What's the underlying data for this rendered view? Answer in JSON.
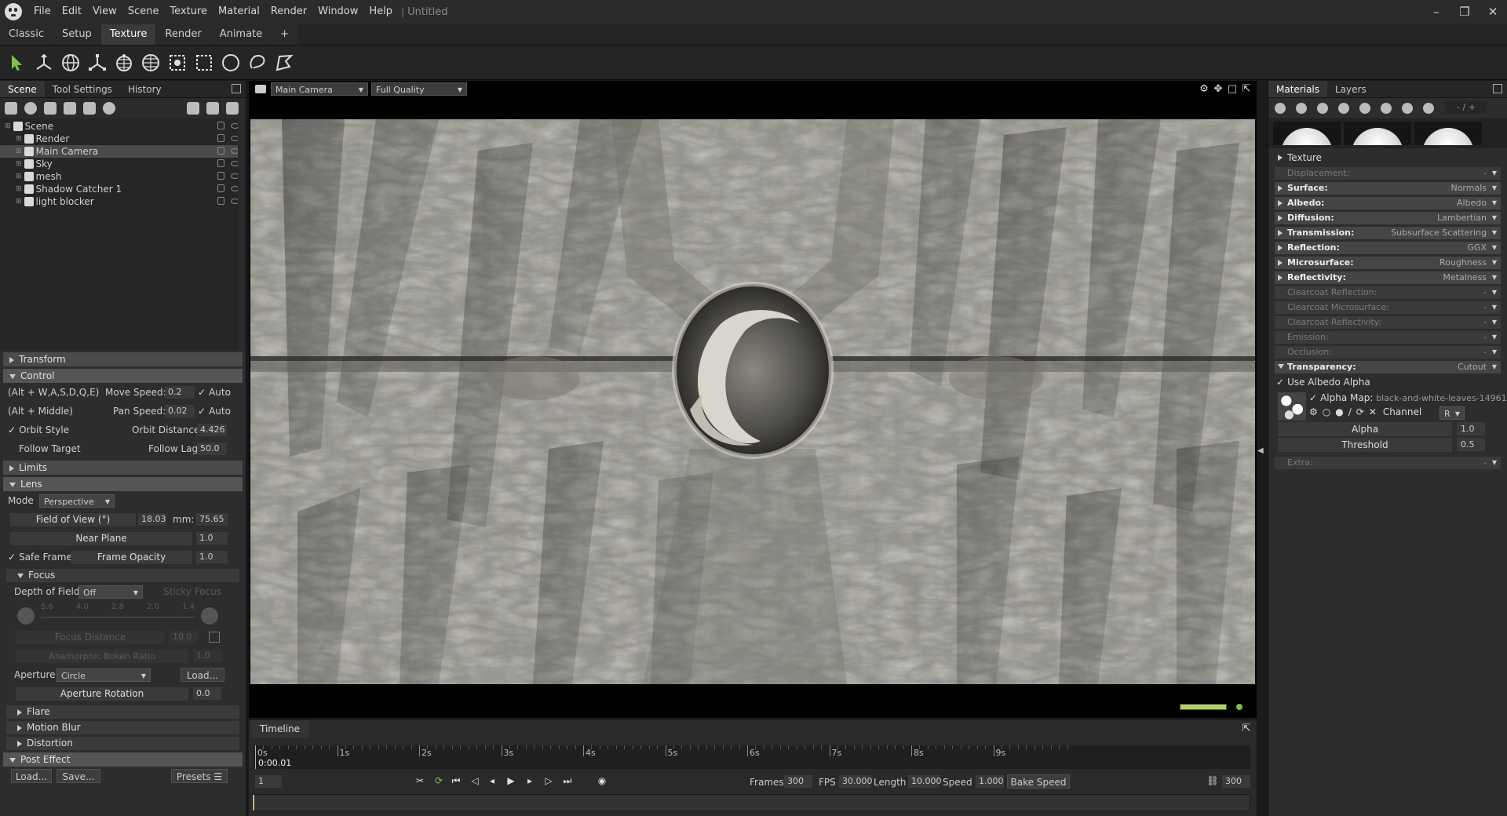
{
  "window": {
    "menu": [
      "File",
      "Edit",
      "View",
      "Scene",
      "Texture",
      "Material",
      "Render",
      "Window",
      "Help"
    ],
    "separator": "|",
    "doc_title": "Untitled",
    "controls": {
      "minimize": "–",
      "maximize": "❐",
      "close": "✕"
    }
  },
  "workspace_tabs": [
    {
      "label": "Classic",
      "active": false
    },
    {
      "label": "Setup",
      "active": false
    },
    {
      "label": "Texture",
      "active": true
    },
    {
      "label": "Render",
      "active": false
    },
    {
      "label": "Animate",
      "active": false
    },
    {
      "label": "+",
      "active": false
    }
  ],
  "toolbar": {
    "tools": [
      "select-arrow-icon",
      "translate-icon",
      "rotate-icon",
      "scale-icon",
      "lattice-icon",
      "globe-icon",
      "box-select-icon",
      "rect-select-icon",
      "circle-select-icon",
      "lasso-select-icon",
      "poly-select-icon"
    ],
    "accent": "#7fc14b"
  },
  "left_panel": {
    "tabs": [
      "Scene",
      "Tool Settings",
      "History"
    ],
    "scene_tree": [
      {
        "label": "Scene",
        "indent": 0,
        "icon": "scene-icon",
        "selected": false
      },
      {
        "label": "Render",
        "indent": 1,
        "icon": "render-icon",
        "selected": false
      },
      {
        "label": "Main Camera",
        "indent": 1,
        "icon": "camera-icon",
        "selected": true
      },
      {
        "label": "Sky",
        "indent": 1,
        "icon": "sky-icon",
        "selected": false
      },
      {
        "label": "mesh",
        "indent": 1,
        "icon": "mesh-icon",
        "selected": false
      },
      {
        "label": "Shadow Catcher 1",
        "indent": 1,
        "icon": "shadow-catcher-icon",
        "selected": false
      },
      {
        "label": "light blocker",
        "indent": 1,
        "icon": "mesh-icon",
        "selected": false
      }
    ],
    "sections": {
      "transform": "Transform",
      "control": "Control",
      "limits": "Limits",
      "lens": "Lens",
      "focus": "Focus",
      "flare": "Flare",
      "motion_blur": "Motion Blur",
      "distortion": "Distortion",
      "post_effect": "Post Effect"
    },
    "control": {
      "keys_hint": "(Alt + W,A,S,D,Q,E)",
      "move_speed_label": "Move Speed:",
      "move_speed": "0.2",
      "auto1": "Auto",
      "mouse_hint": "(Alt + Middle)",
      "pan_speed_label": "Pan Speed:",
      "pan_speed": "0.02",
      "auto2": "Auto",
      "orbit_style": "Orbit Style",
      "orbit_distance_label": "Orbit Distance:",
      "orbit_distance": "4.426",
      "follow_target": "Follow Target",
      "follow_lag_label": "Follow Lag",
      "follow_lag": "50.0"
    },
    "lens": {
      "mode_label": "Mode",
      "mode": "Perspective",
      "fov_label": "Field of View (°)",
      "fov": "18.03",
      "mm_label": "mm:",
      "mm": "75.65",
      "near_plane_label": "Near Plane",
      "near_plane": "1.0",
      "safe_frame": "Safe Frame",
      "frame_opacity_label": "Frame Opacity",
      "frame_opacity": "1.0"
    },
    "focus": {
      "dof_label": "Depth of Field",
      "dof": "Off",
      "sticky_focus": "Sticky Focus",
      "fstops": [
        "5.6",
        "4.0",
        "2.8",
        "2.0",
        "1.4"
      ],
      "focus_distance_label": "Focus Distance",
      "focus_distance": "10.0",
      "anamorphic_label": "Anamorphic Bokeh Ratio",
      "anamorphic": "1.0",
      "aperture_label": "Aperture",
      "aperture": "Circle",
      "load_label": "Load...",
      "aperture_rotation_label": "Aperture Rotation",
      "aperture_rotation": "0.0"
    },
    "post_effect": {
      "load": "Load...",
      "save": "Save...",
      "presets": "Presets"
    }
  },
  "viewport": {
    "camera": "Main Camera",
    "quality": "Full Quality",
    "progress": 1.0
  },
  "timeline": {
    "tab": "Timeline",
    "ticks": [
      "0s",
      "1s",
      "2s",
      "3s",
      "4s",
      "5s",
      "6s",
      "7s",
      "8s",
      "9s"
    ],
    "current_time": "0:00.01",
    "frame": "1",
    "frames_label": "Frames",
    "frames": "300",
    "fps_label": "FPS",
    "fps": "30.000",
    "length_label": "Length",
    "length": "10.000",
    "speed_label": "Speed",
    "speed": "1.000",
    "bake_speed": "Bake Speed",
    "end_frame": "300"
  },
  "right_panel": {
    "tabs": [
      "Materials",
      "Layers"
    ],
    "counter": "- / +",
    "texture_section": "Texture",
    "material_rows": [
      {
        "label": "Displacement:",
        "value": "-",
        "active": false
      },
      {
        "label": "Surface:",
        "value": "Normals",
        "active": true
      },
      {
        "label": "Albedo:",
        "value": "Albedo",
        "active": true
      },
      {
        "label": "Diffusion:",
        "value": "Lambertian",
        "active": true
      },
      {
        "label": "Transmission:",
        "value": "Subsurface Scattering",
        "active": true
      },
      {
        "label": "Reflection:",
        "value": "GGX",
        "active": true
      },
      {
        "label": "Microsurface:",
        "value": "Roughness",
        "active": true
      },
      {
        "label": "Reflectivity:",
        "value": "Metalness",
        "active": true
      },
      {
        "label": "Clearcoat Reflection:",
        "value": "-",
        "active": false
      },
      {
        "label": "Clearcoat Microsurface:",
        "value": "-",
        "active": false
      },
      {
        "label": "Clearcoat Reflectivity:",
        "value": "-",
        "active": false
      },
      {
        "label": "Emission:",
        "value": "-",
        "active": false
      },
      {
        "label": "Occlusion:",
        "value": "-",
        "active": false
      }
    ],
    "transparency": {
      "label": "Transparency:",
      "value": "Cutout",
      "use_albedo_alpha": "Use Albedo Alpha",
      "alpha_map_label": "Alpha Map:",
      "alpha_map": "black-and-white-leaves-14961",
      "channel_label": "Channel",
      "channel": "R",
      "alpha_label": "Alpha",
      "alpha": "1.0",
      "threshold_label": "Threshold",
      "threshold": "0.5"
    },
    "extra": {
      "label": "Extra:",
      "value": "-"
    }
  }
}
